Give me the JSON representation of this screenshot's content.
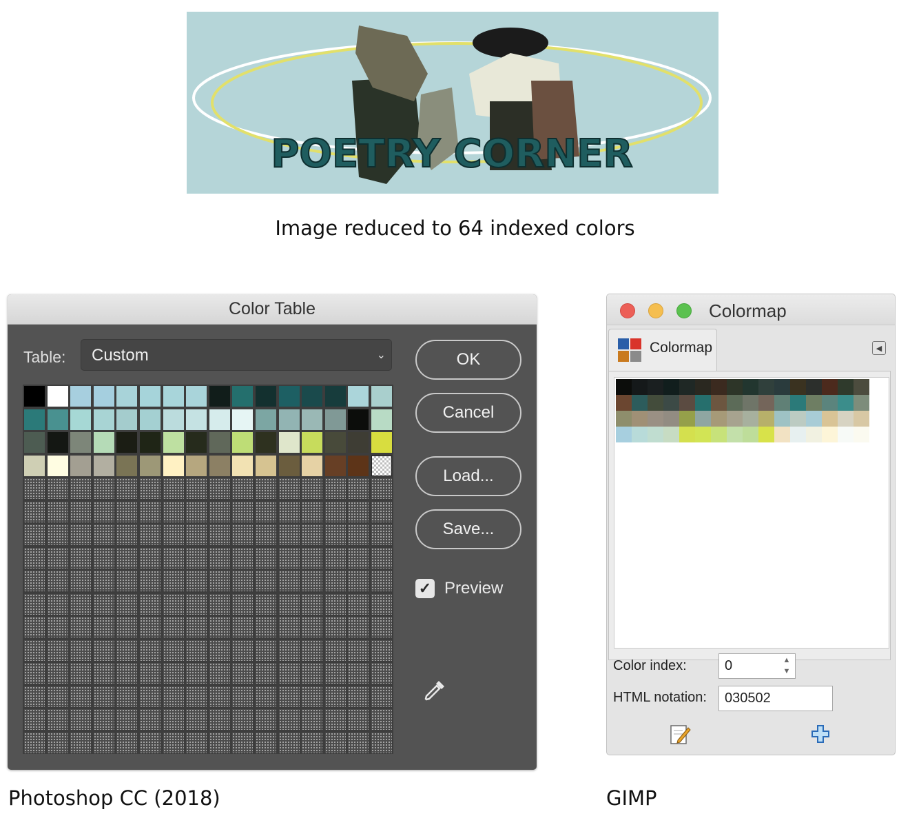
{
  "captions": {
    "top": "Image reduced to 64 indexed colors",
    "photoshop": "Photoshop CC (2018)",
    "gimp": "GIMP"
  },
  "banner": {
    "text": "POETRY CORNER",
    "background": "#b5d5d8"
  },
  "photoshop": {
    "title": "Color Table",
    "table_label": "Table:",
    "table_value": "Custom",
    "buttons": {
      "ok": "OK",
      "cancel": "Cancel",
      "load": "Load...",
      "save": "Save..."
    },
    "preview_label": "Preview",
    "preview_checked": true,
    "grid_rows": 16,
    "grid_cols": 16,
    "palette": [
      "#000000",
      "#ffffff",
      "#a7cfdf",
      "#a5cfdf",
      "#a8d3d9",
      "#a6d4da",
      "#a8d5da",
      "#a9d4da",
      "#111d1a",
      "#246f6d",
      "#13302f",
      "#1d5f63",
      "#1a4a4c",
      "#173c3c",
      "#abd5da",
      "#a9cfcd",
      "#2b7a79",
      "#499190",
      "#a6d8d5",
      "#a8d4d4",
      "#a4cccd",
      "#a4d0d2",
      "#bbdcdd",
      "#c5e2e3",
      "#d6ecec",
      "#e6f5f4",
      "#7ca6a3",
      "#92b4b3",
      "#9ab8b5",
      "#809996",
      "#0c0d0b",
      "#b8dbc5",
      "#4d5c52",
      "#141713",
      "#7d8679",
      "#b5dbb7",
      "#1b1d14",
      "#1f2516",
      "#bee0a1",
      "#262b1c",
      "#60685a",
      "#bedd76",
      "#2e311f",
      "#dfe6cb",
      "#c7dc5c",
      "#484a3a",
      "#3e3d34",
      "#d8dd3f",
      "#cfcfb4",
      "#fffde2",
      "#a39f92",
      "#b2afa1",
      "#7a7455",
      "#9d9877",
      "#fff1c3",
      "#b6a77f",
      "#8c8064",
      "#f2e2b3",
      "#d6c391",
      "#6b5d3e",
      "#e6d2a5",
      "#673f25",
      "#5d3418",
      "checker"
    ]
  },
  "gimp": {
    "window_title": "Colormap",
    "tab_label": "Colormap",
    "color_index_label": "Color index:",
    "color_index_value": "0",
    "html_notation_label": "HTML notation:",
    "html_notation_value": "030502",
    "colormap_cols": 16,
    "colormap": [
      "#0c0d0b",
      "#15191a",
      "#1a1f20",
      "#111e1d",
      "#1f2825",
      "#2a2820",
      "#3b2a1f",
      "#2d3528",
      "#22362f",
      "#30403c",
      "#2a3b3d",
      "#3a3220",
      "#2c2f2c",
      "#4c2a1d",
      "#2f3a2c",
      "#4c4c3e",
      "#6b4630",
      "#2c5c5c",
      "#434c3b",
      "#3c4a46",
      "#5b4b41",
      "#266f6d",
      "#6c5640",
      "#5c6b58",
      "#6f7568",
      "#74655a",
      "#608076",
      "#2b7a79",
      "#6e7e63",
      "#5b847d",
      "#3b8d8b",
      "#7d8d7b",
      "#8e8e6c",
      "#a09076",
      "#9a9084",
      "#928c82",
      "#95a04a",
      "#8fa6a2",
      "#a69a78",
      "#a7a38f",
      "#a7b09e",
      "#b7b06a",
      "#9ec2c4",
      "#bccbc2",
      "#a8ccd6",
      "#d9c496",
      "#d7d3c2",
      "#d8c8a4",
      "#a7cfdf",
      "#b8dbd9",
      "#c0ddd0",
      "#c7dcc3",
      "#d4e04e",
      "#d2e455",
      "#c7e27a",
      "#c3e0aa",
      "#bedd9a",
      "#d8e24a",
      "#f2e2c3",
      "#e7f0f0",
      "#f1f1e1",
      "#fdf5d8",
      "#f7faf7",
      "#fbfaf0"
    ]
  }
}
